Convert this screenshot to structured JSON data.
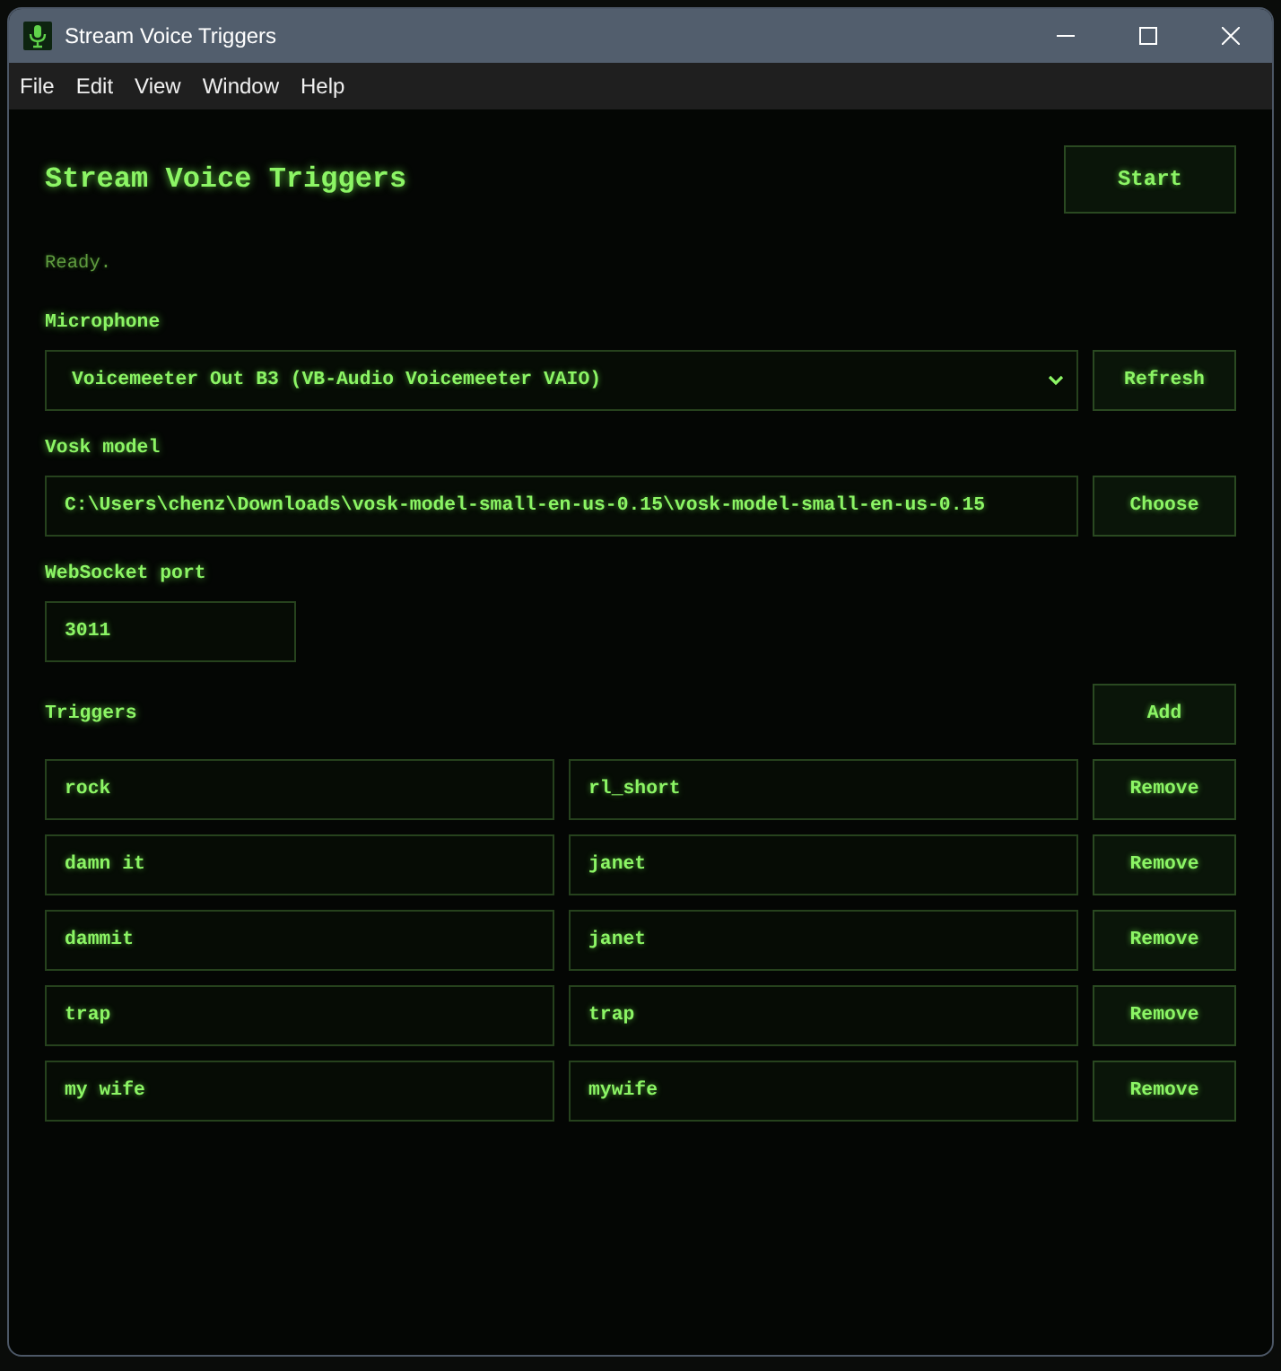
{
  "window": {
    "title": "Stream Voice Triggers"
  },
  "menu_bar": {
    "items": [
      "File",
      "Edit",
      "View",
      "Window",
      "Help"
    ]
  },
  "header": {
    "heading": "Stream Voice Triggers",
    "start_button": "Start"
  },
  "status": "Ready.",
  "microphone": {
    "label": "Microphone",
    "value": "Voicemeeter Out B3 (VB-Audio Voicemeeter VAIO)",
    "button": "Refresh"
  },
  "vosk_model": {
    "label": "Vosk model",
    "value": "C:\\Users\\chenz\\Downloads\\vosk-model-small-en-us-0.15\\vosk-model-small-en-us-0.15",
    "button": "Choose"
  },
  "websocket_port": {
    "label": "WebSocket port",
    "value": "3011"
  },
  "triggers": {
    "label": "Triggers",
    "add_button": "Add",
    "rows": [
      {
        "field_1": "rock",
        "field_2": "rl_short",
        "button": "Remove"
      },
      {
        "field_1": "damn it",
        "field_2": "janet",
        "button": "Remove"
      },
      {
        "field_1": "dammit",
        "field_2": "janet",
        "button": "Remove"
      },
      {
        "field_1": "trap",
        "field_2": "trap",
        "button": "Remove"
      },
      {
        "field_1": "my wife",
        "field_2": "mywife",
        "button": "Remove"
      }
    ]
  }
}
